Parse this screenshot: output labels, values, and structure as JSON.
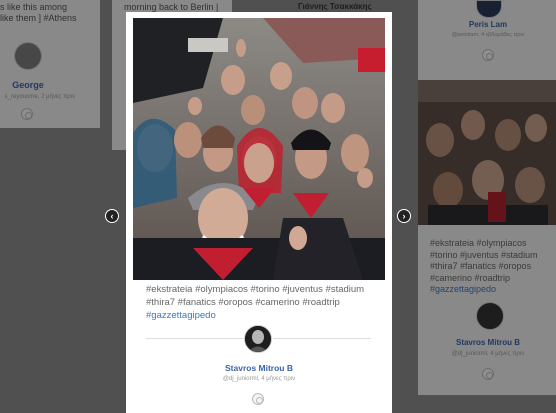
{
  "background": {
    "left_card": {
      "text_top_line1": "s like this among",
      "text_top_line2": "like them ] #Athens",
      "user_name": "George",
      "user_meta": "ε_reyouome, 2 μήνες πριν"
    },
    "center_card": {
      "text_top": "morning back to Berlin |"
    },
    "top_center_name": "Γιάννης Τσακκάκης",
    "right_card": {
      "top_user_name": "Peris Lam",
      "top_user_meta": "@perislam, 4 εβδομάδες πριν",
      "hashtags": "#ekstrateia #olympiacos #torino #juventus #stadium #thira7 #fanatics #oropos #camerino #roadtrip",
      "hashtag_link": "#gazzettagipedo",
      "user_name": "Stavros Mitrou B",
      "user_meta": "@dj_juniorml, 4 μήνες πριν"
    }
  },
  "modal": {
    "hashtags": "#ekstrateia #olympiacos #torino #juventus #stadium #thira7 #fanatics #oropos #camerino #roadtrip",
    "hashtag_link": "#gazzettagipedo",
    "user_name": "Stavros Mitrou B",
    "user_meta": "@dj_juniorml, 4 μήνες πριν",
    "prev_icon": "chevron-left-icon",
    "next_icon": "chevron-right-icon",
    "like_icon": "like-icon"
  },
  "colors": {
    "link": "#3b78b8",
    "name": "#3a63a8",
    "overlay": "rgba(0,0,0,0.42)"
  }
}
